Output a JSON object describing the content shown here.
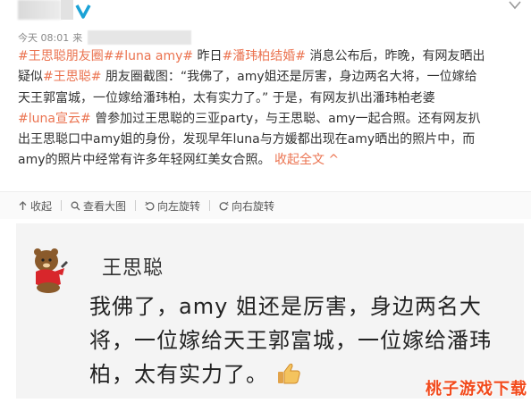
{
  "header": {
    "verified_icon": "verified-v-icon",
    "time": "今天 08:01",
    "source_prefix": "来"
  },
  "post": {
    "lines": [
      {
        "tag1": "#王思聪朋友圈#",
        "tag2": "#luna amy#",
        "t1": " 昨日",
        "tag3": "#潘玮柏结婚#",
        "t2": " 消息公布后，昨晚，有网友晒出"
      },
      {
        "t": "疑似",
        "tag": "#王思聪#",
        "t2": " 朋友圈截图：“我佛了，amy姐还是厉害，身边两名大将，一位嫁给"
      },
      {
        "t": "天王郭富城，一位嫁给潘玮柏，太有实力了。” 于是，有网友扒出潘玮柏老婆"
      },
      {
        "tag": "#luna宣云#",
        "t": " 曾参加过王思聪的三亚party，与王思聪、amy一起合照。还有网友扒"
      },
      {
        "t": "出王思聪口中amy姐的身份，发现早年luna与方媛都出现在amy晒出的照片中，而"
      },
      {
        "t": "amy的照片中经常有许多年轻网红美女合照。",
        "fold": "收起全文 ^"
      }
    ]
  },
  "toolbar": {
    "collapse": "收起",
    "view_large": "查看大图",
    "rotate_left": "向左旋转",
    "rotate_right": "向右旋转"
  },
  "card": {
    "name": "王思聪",
    "line1": "我佛了，amy 姐还是厉害，身边两名大",
    "line2": "将，一位嫁给天王郭富城，一位嫁给潘玮",
    "line3": "柏，太有实力了。",
    "emoji": "thumbs-up-icon"
  },
  "watermark": "桃子游戏下载",
  "colors": {
    "tag": "#eb7350",
    "watermark": "#f24a1c",
    "verified": "#1aa2d6"
  }
}
